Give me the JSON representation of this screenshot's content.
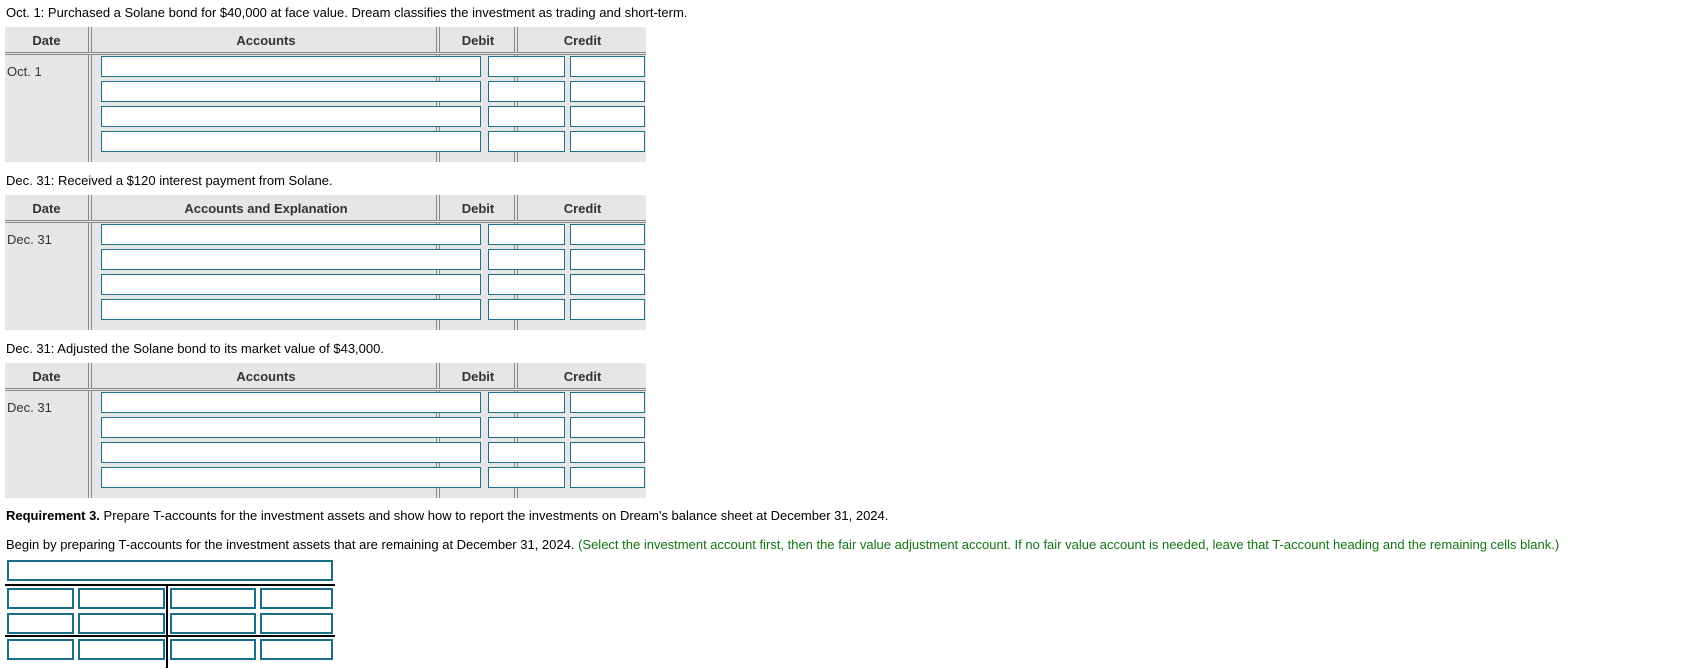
{
  "transactions": [
    {
      "prompt": "Oct. 1: Purchased a Solane bond for $40,000 at face value. Dream classifies the investment as trading and short-term.",
      "columns": {
        "date": "Date",
        "accounts": "Accounts",
        "debit": "Debit",
        "credit": "Credit"
      },
      "date": "Oct. 1",
      "rows": [
        {
          "account": "",
          "debit": "",
          "credit": ""
        },
        {
          "account": "",
          "debit": "",
          "credit": ""
        },
        {
          "account": "",
          "debit": "",
          "credit": ""
        },
        {
          "account": "",
          "debit": "",
          "credit": ""
        }
      ]
    },
    {
      "prompt": "Dec. 31: Received a $120 interest payment from Solane.",
      "columns": {
        "date": "Date",
        "accounts": "Accounts and Explanation",
        "debit": "Debit",
        "credit": "Credit"
      },
      "date": "Dec. 31",
      "rows": [
        {
          "account": "",
          "debit": "",
          "credit": ""
        },
        {
          "account": "",
          "debit": "",
          "credit": ""
        },
        {
          "account": "",
          "debit": "",
          "credit": ""
        },
        {
          "account": "",
          "debit": "",
          "credit": ""
        }
      ]
    },
    {
      "prompt": "Dec. 31: Adjusted the Solane bond to its market value of $43,000.",
      "columns": {
        "date": "Date",
        "accounts": "Accounts",
        "debit": "Debit",
        "credit": "Credit"
      },
      "date": "Dec. 31",
      "rows": [
        {
          "account": "",
          "debit": "",
          "credit": ""
        },
        {
          "account": "",
          "debit": "",
          "credit": ""
        },
        {
          "account": "",
          "debit": "",
          "credit": ""
        },
        {
          "account": "",
          "debit": "",
          "credit": ""
        }
      ]
    }
  ],
  "requirement": {
    "label": "Requirement 3.",
    "text": " Prepare T-accounts for the investment assets and show how to report the investments on Dream's balance sheet at December 31, 2024."
  },
  "instruction": {
    "text": "Begin by preparing T-accounts for the investment assets that are remaining at December 31, 2024. ",
    "hint": "(Select the investment account first, then the fair value adjustment account. If no fair value account is needed, leave that T-account heading and the remaining cells blank.)"
  },
  "t_account": {
    "heading": "",
    "rows": [
      {
        "left_label": "",
        "left_value": "",
        "right_label": "",
        "right_value": ""
      },
      {
        "left_label": "",
        "left_value": "",
        "right_label": "",
        "right_value": ""
      },
      {
        "left_label": "",
        "left_value": "",
        "right_label": "",
        "right_value": ""
      }
    ]
  },
  "colors": {
    "input_border": "#1d6f8e",
    "header_bg": "#e6e6e6",
    "hint_green": "#137313"
  }
}
